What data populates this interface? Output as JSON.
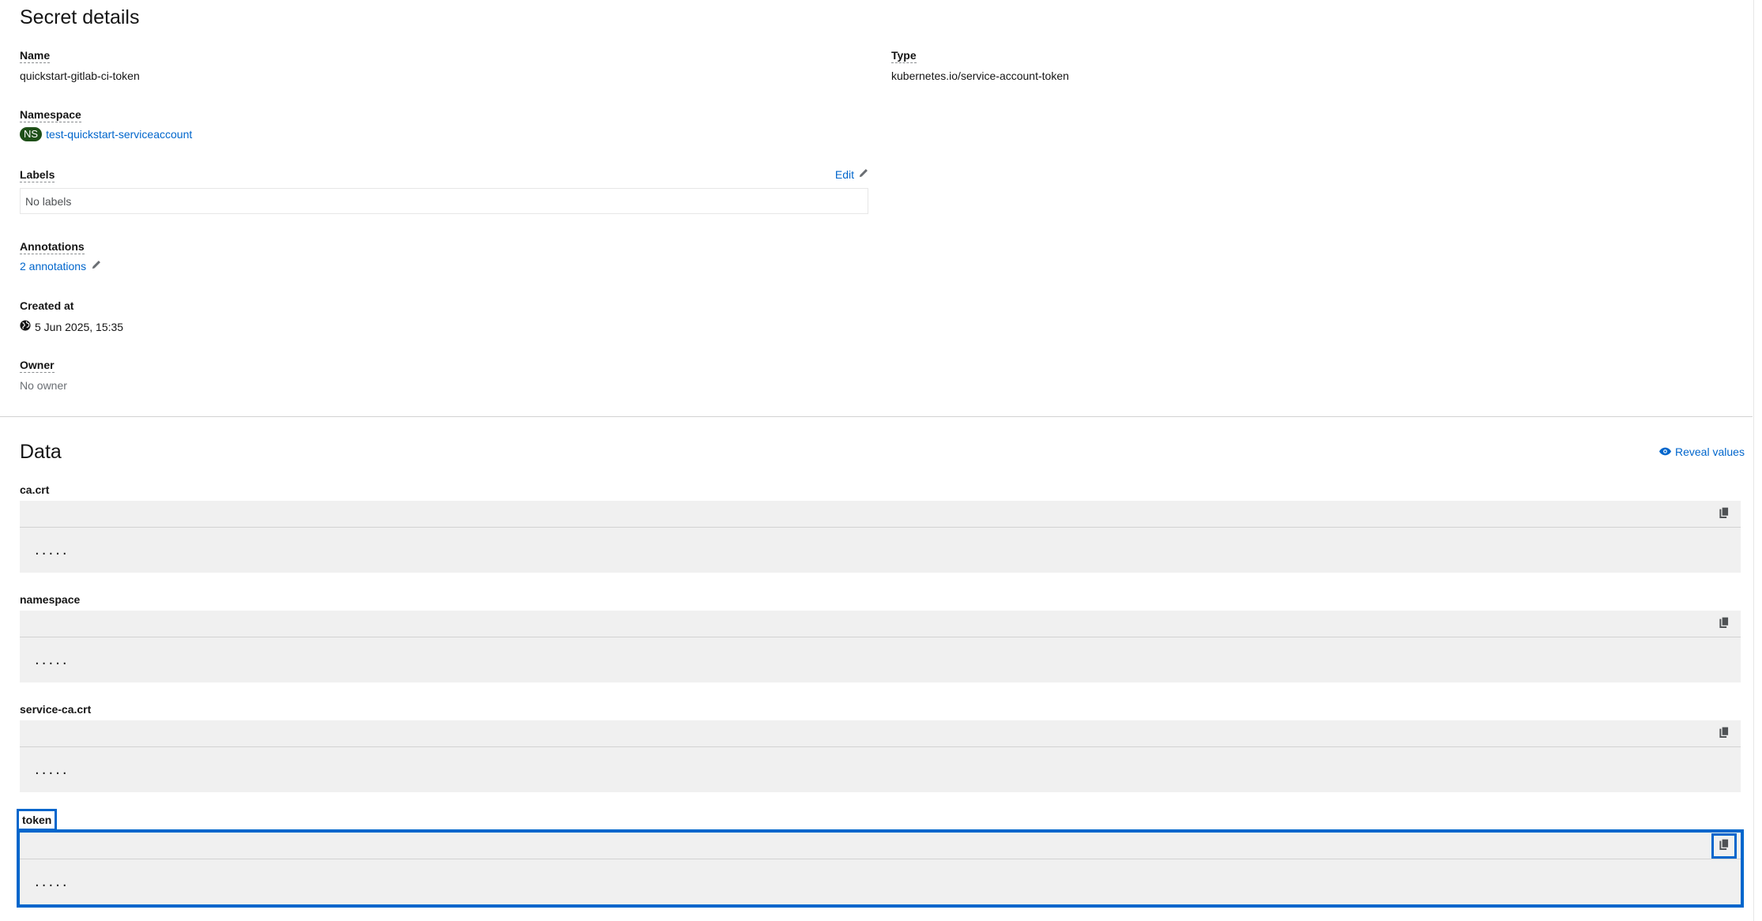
{
  "secret_details": {
    "title": "Secret details",
    "name_label": "Name",
    "name_value": "quickstart-gitlab-ci-token",
    "type_label": "Type",
    "type_value": "kubernetes.io/service-account-token",
    "namespace_label": "Namespace",
    "namespace_badge": "NS",
    "namespace_value": "test-quickstart-serviceaccount",
    "labels_label": "Labels",
    "labels_edit": "Edit",
    "labels_value": "No labels",
    "annotations_label": "Annotations",
    "annotations_value": "2 annotations",
    "created_label": "Created at",
    "created_value": "5 Jun 2025, 15:35",
    "owner_label": "Owner",
    "owner_value": "No owner"
  },
  "data_section": {
    "title": "Data",
    "reveal_label": "Reveal values",
    "items": [
      {
        "key": "ca.crt",
        "masked": "....."
      },
      {
        "key": "namespace",
        "masked": "....."
      },
      {
        "key": "service-ca.crt",
        "masked": "....."
      },
      {
        "key": "token",
        "masked": "....."
      }
    ]
  },
  "colors": {
    "link": "#0066cc",
    "ns_badge": "#1e4f18",
    "panel_bg": "#f0f0f0",
    "highlight": "#0066cc"
  },
  "icons": [
    "pencil-icon",
    "globe-icon",
    "eye-icon",
    "copy-icon"
  ]
}
